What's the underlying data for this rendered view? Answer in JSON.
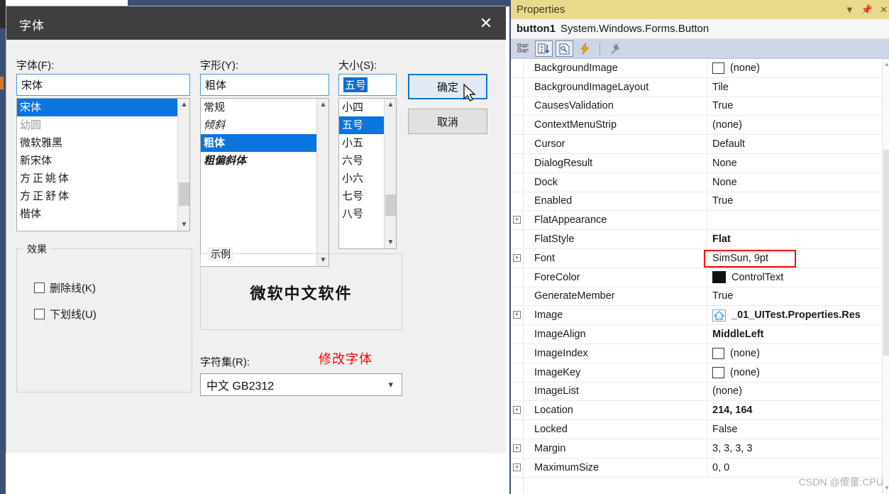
{
  "dialog": {
    "title": "字体",
    "close_icon": "close-icon",
    "font_label": "字体(F):",
    "font_value": "宋体",
    "font_list": [
      "宋体",
      "幼圆",
      "微软雅黑",
      "新宋体",
      "方正姚体",
      "方正舒体",
      "楷体"
    ],
    "font_selected_index": 0,
    "style_label": "字形(Y):",
    "style_value": "粗体",
    "style_list": [
      "常规",
      "倾斜",
      "粗体",
      "粗偏斜体"
    ],
    "style_selected_index": 2,
    "size_label": "大小(S):",
    "size_value": "五号",
    "size_list": [
      "小四",
      "五号",
      "小五",
      "六号",
      "小六",
      "七号",
      "八号"
    ],
    "size_selected_index": 1,
    "ok_button": "确定",
    "cancel_button": "取消",
    "effects_group": "效果",
    "effect_strikeout": "删除线(K)",
    "effect_underline": "下划线(U)",
    "sample_group": "示例",
    "sample_text": "微软中文软件",
    "charset_label": "字符集(R):",
    "charset_value": "中文 GB2312",
    "annotation": "修改字体",
    "annotation_color": "#ff0000",
    "selection_color": "#0b74de"
  },
  "properties": {
    "panel_title": "Properties",
    "title_icons": [
      "chevron-down-icon",
      "pin-icon",
      "close-icon"
    ],
    "object_name": "button1",
    "object_type": "System.Windows.Forms.Button",
    "toolbar": {
      "categorized": "categorized-view-icon",
      "alphabetical": "alphabetical-sort-icon",
      "property_pages": "property-pages-icon",
      "events": "events-lightning-icon",
      "wrench": "wrench-icon"
    },
    "highlight_color": "#ff0000",
    "rows": [
      {
        "expandable": false,
        "name": "BackgroundImage",
        "value": "(none)",
        "swatch": "empty",
        "bold": false
      },
      {
        "expandable": false,
        "name": "BackgroundImageLayout",
        "value": "Tile",
        "swatch": "none",
        "bold": false
      },
      {
        "expandable": false,
        "name": "CausesValidation",
        "value": "True",
        "swatch": "none",
        "bold": false
      },
      {
        "expandable": false,
        "name": "ContextMenuStrip",
        "value": "(none)",
        "swatch": "none",
        "bold": false
      },
      {
        "expandable": false,
        "name": "Cursor",
        "value": "Default",
        "swatch": "none",
        "bold": false
      },
      {
        "expandable": false,
        "name": "DialogResult",
        "value": "None",
        "swatch": "none",
        "bold": false
      },
      {
        "expandable": false,
        "name": "Dock",
        "value": "None",
        "swatch": "none",
        "bold": false
      },
      {
        "expandable": false,
        "name": "Enabled",
        "value": "True",
        "swatch": "none",
        "bold": false
      },
      {
        "expandable": true,
        "name": "FlatAppearance",
        "value": "",
        "swatch": "none",
        "bold": false
      },
      {
        "expandable": false,
        "name": "FlatStyle",
        "value": "Flat",
        "swatch": "none",
        "bold": true
      },
      {
        "expandable": true,
        "name": "Font",
        "value": "SimSun, 9pt",
        "swatch": "none",
        "bold": false,
        "highlighted": true
      },
      {
        "expandable": false,
        "name": "ForeColor",
        "value": "ControlText",
        "swatch": "black",
        "bold": false
      },
      {
        "expandable": false,
        "name": "GenerateMember",
        "value": "True",
        "swatch": "none",
        "bold": false
      },
      {
        "expandable": true,
        "name": "Image",
        "value": "_01_UITest.Properties.Res",
        "swatch": "image",
        "bold": true
      },
      {
        "expandable": false,
        "name": "ImageAlign",
        "value": "MiddleLeft",
        "swatch": "none",
        "bold": true
      },
      {
        "expandable": false,
        "name": "ImageIndex",
        "value": "(none)",
        "swatch": "empty",
        "bold": false
      },
      {
        "expandable": false,
        "name": "ImageKey",
        "value": "(none)",
        "swatch": "empty",
        "bold": false
      },
      {
        "expandable": false,
        "name": "ImageList",
        "value": "(none)",
        "swatch": "none",
        "bold": false
      },
      {
        "expandable": true,
        "name": "Location",
        "value": "214, 164",
        "swatch": "none",
        "bold": true
      },
      {
        "expandable": false,
        "name": "Locked",
        "value": "False",
        "swatch": "none",
        "bold": false
      },
      {
        "expandable": true,
        "name": "Margin",
        "value": "3, 3, 3, 3",
        "swatch": "none",
        "bold": false
      },
      {
        "expandable": true,
        "name": "MaximumSize",
        "value": "0, 0",
        "swatch": "none",
        "bold": false
      }
    ]
  },
  "watermark": "CSDN @傻童:CPU"
}
